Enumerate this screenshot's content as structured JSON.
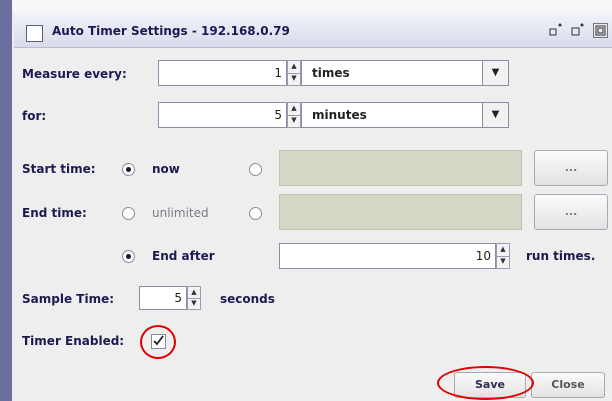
{
  "window": {
    "title": "Auto Timer Settings - 192.168.0.79",
    "controls": {
      "minimize_icon": "minimize-icon",
      "maximize_icon": "maximize-icon",
      "close_icon": "close-icon"
    }
  },
  "measure": {
    "label": "Measure every:",
    "value": "1",
    "unit_selected": "times"
  },
  "for_row": {
    "label": "for:",
    "value": "5",
    "unit_selected": "minutes"
  },
  "start_time": {
    "label": "Start time:",
    "option_now": "now",
    "browse_label": "..."
  },
  "end_time": {
    "label": "End time:",
    "option_unlimited": "unlimited",
    "browse_label": "...",
    "option_end_after": "End after",
    "end_after_value": "10",
    "end_after_unit": "run times."
  },
  "sample_time": {
    "label": "Sample Time:",
    "value": "5",
    "unit": "seconds"
  },
  "timer_enabled": {
    "label": "Timer Enabled:",
    "checked": true
  },
  "buttons": {
    "save": "Save",
    "close": "Close"
  },
  "annotation_color": "#e00000"
}
